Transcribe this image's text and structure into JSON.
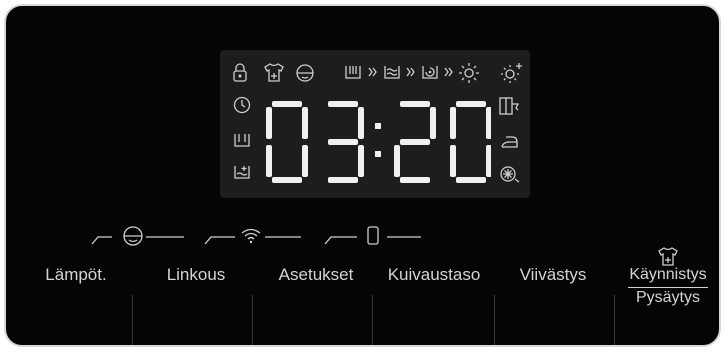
{
  "display": {
    "time_digits": [
      "0",
      "3",
      "2",
      "0"
    ],
    "time_text": "03:20",
    "segment_color": "#f0f0f0",
    "lcd_background": "#1d1d1d"
  },
  "status_icons": {
    "top_row": [
      "lock-icon",
      "shirt-plus-icon",
      "child-face-icon",
      "wash-icon",
      "chevron-icon",
      "rinse-icon",
      "chevron-icon",
      "spin-icon",
      "chevron-icon",
      "dry-sun-icon",
      "dry-sun-plus-icon"
    ],
    "left_column": [
      "clock-icon",
      "wash-tub-icon",
      "prewash-tub-icon"
    ],
    "right_column": [
      "wardrobe-dry-icon",
      "iron-dry-icon",
      "anti-crease-icon"
    ]
  },
  "indicators": [
    "child-lock-indicator",
    "wifi-indicator",
    "phone-indicator"
  ],
  "buttons": {
    "temperature": "Lämpöt.",
    "spin": "Linkous",
    "settings": "Asetukset",
    "dry_level": "Kuivaustaso",
    "delay": "Viivästys",
    "start_line1": "Käynnistys",
    "start_line2": "Pysäytys"
  }
}
